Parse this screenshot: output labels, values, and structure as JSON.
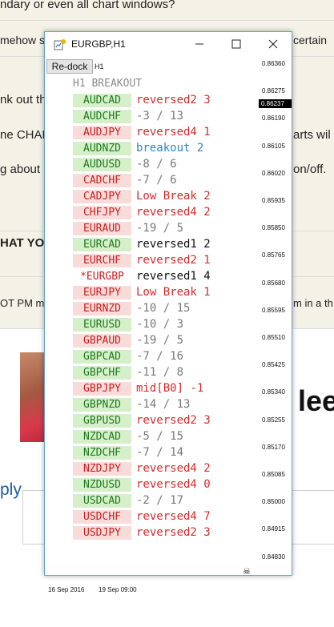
{
  "background": {
    "lines": [
      "ndary or even all chart windows?",
      "mehow s",
      "certain",
      "nk out th",
      "ne CHAN",
      "arts wil",
      "g about",
      "on/off.",
      "HAT YO",
      "OT PM m",
      "m in a th"
    ],
    "big_text": "lee",
    "reply_label": "ply"
  },
  "window": {
    "title": "EURGBP,H1",
    "redock_label": "Re-dock",
    "timeframe_label": "H1",
    "panel_title": "H1 BREAKOUT",
    "rows": [
      {
        "symbol": "AUDCAD",
        "value": "reversed2 3"
      },
      {
        "symbol": "AUDCHF",
        "value": "-3 / 13"
      },
      {
        "symbol": "AUDJPY",
        "value": "reversed4 1"
      },
      {
        "symbol": "AUDNZD",
        "value": "breakout 2"
      },
      {
        "symbol": "AUDUSD",
        "value": "-8 / 6"
      },
      {
        "symbol": "CADCHF",
        "value": "-7 / 6"
      },
      {
        "symbol": "CADJPY",
        "value": "Low Break 2"
      },
      {
        "symbol": "CHFJPY",
        "value": "reversed4 2"
      },
      {
        "symbol": "EURAUD",
        "value": "-19 / 5"
      },
      {
        "symbol": "EURCAD",
        "value": "reversed1 2"
      },
      {
        "symbol": "EURCHF",
        "value": "reversed2 1"
      },
      {
        "symbol": "*EURGBP",
        "value": "reversed1 4"
      },
      {
        "symbol": "EURJPY",
        "value": "Low Break 1"
      },
      {
        "symbol": "EURNZD",
        "value": "-10 / 15"
      },
      {
        "symbol": "EURUSD",
        "value": "-10 / 3"
      },
      {
        "symbol": "GBPAUD",
        "value": "-19 / 5"
      },
      {
        "symbol": "GBPCAD",
        "value": "-7 / 16"
      },
      {
        "symbol": "GBPCHF",
        "value": "-11 / 8"
      },
      {
        "symbol": "GBPJPY",
        "value": "mid[B0] -1"
      },
      {
        "symbol": "GBPNZD",
        "value": "-14 / 13"
      },
      {
        "symbol": "GBPUSD",
        "value": "reversed2 3"
      },
      {
        "symbol": "NZDCAD",
        "value": "-5 / 15"
      },
      {
        "symbol": "NZDCHF",
        "value": "-7 / 14"
      },
      {
        "symbol": "NZDJPY",
        "value": "reversed4 2"
      },
      {
        "symbol": "NZDUSD",
        "value": "reversed4 0"
      },
      {
        "symbol": "USDCAD",
        "value": "-2 / 17"
      },
      {
        "symbol": "USDCHF",
        "value": "reversed4 7"
      },
      {
        "symbol": "USDJPY",
        "value": "reversed2 3"
      }
    ],
    "price_labels": [
      "0.86360",
      "0.86275",
      "0.86190",
      "0.86105",
      "0.86020",
      "0.85935",
      "0.85850",
      "0.85765",
      "0.85680",
      "0.85595",
      "0.85510",
      "0.85425",
      "0.85340",
      "0.85255",
      "0.85170",
      "0.85085",
      "0.85000",
      "0.84915",
      "0.84830"
    ],
    "current_price": "0.86237",
    "date_labels": [
      "16 Sep 2016",
      "19 Sep 09:00"
    ]
  }
}
